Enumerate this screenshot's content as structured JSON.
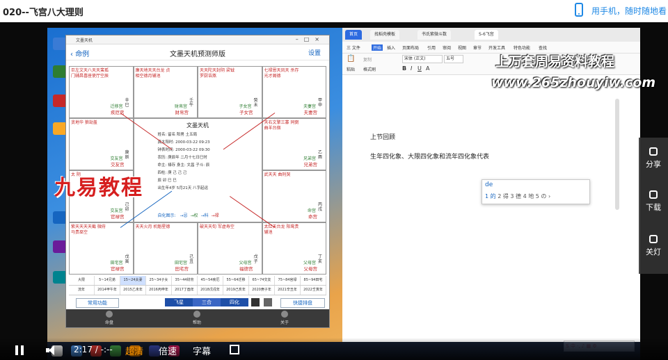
{
  "video": {
    "title": "020--飞宫八大理则",
    "mobile_link": "用手机，随时随地看"
  },
  "fushu": {
    "window_title": "文墨天机",
    "back_label": "命例",
    "app_title": "文墨天机预测师版",
    "settings_label": "设置",
    "palaces": [
      {
        "pos": "tl",
        "name": "疾厄宫",
        "gz": "辛巳",
        "stars": "巨左文天八天天蜚孤 门辅昌喜座使厅空辰",
        "main": "迁移宫"
      },
      {
        "pos": "t2",
        "name": "财帛宫",
        "gz": "壬午",
        "stars": "廉天地天天台龙 贞相空德月辅池",
        "main": "财帛宫"
      },
      {
        "pos": "t3",
        "name": "子女宫",
        "gz": "癸未",
        "stars": "天天陀天封阴 梁钺罗厨诰煞",
        "main": "子女宫"
      },
      {
        "pos": "tr",
        "name": "夫妻宫",
        "gz": "甲申",
        "stars": "七禄恩天凤天 杀存光才阁德",
        "main": "夫妻宫"
      },
      {
        "pos": "l2",
        "name": "交友宫",
        "gz": "庚辰",
        "stars": "贪地华 狼劫盖",
        "main": "交友宫"
      },
      {
        "pos": "r2",
        "name": "兄弟宫",
        "gz": "乙酉",
        "stars": "天右文擎三寡 同弼曲羊台宿",
        "main": "兄弟宫"
      },
      {
        "pos": "l3",
        "name": "官禄宫",
        "gz": "己卯",
        "stars": "太 阴",
        "main": "交友宫"
      },
      {
        "pos": "r3",
        "name": "命宫",
        "gz": "丙戌",
        "stars": "武天天 曲刑哭",
        "main": "命宫"
      },
      {
        "pos": "bl",
        "name": "官禄宫",
        "gz": "戊寅",
        "stars": "紫天天天天截 微府马贵巫空",
        "main": "田宅宫"
      },
      {
        "pos": "b2",
        "name": "田宅宫",
        "gz": "己丑",
        "stars": "天天火月 机魁星德",
        "main": "田宅宫"
      },
      {
        "pos": "b3",
        "name": "福德宫",
        "gz": "戊子",
        "stars": "破天天旬 军虚寿空",
        "main": "父母宫"
      },
      {
        "pos": "br",
        "name": "父母宫",
        "gz": "丁亥",
        "stars": "太红天台龙 阳鸾贵辅池",
        "main": "父母宫"
      }
    ],
    "center": {
      "title": "文墨天机",
      "lines": [
        "姓名: 留名    阳男  土五局",
        "真太阳时: 2000-03-22 09:23",
        "钟表时间: 2000-03-22 09:30",
        "农历: 庚辰年 二月十七日巳时",
        "命主: 禄存  身主: 文昌  子斗: 辰",
        "四柱: 庚  己  己  己",
        "      辰  卯  巳  巳",
        "出生年4岁  5月21天 八字起运"
      ],
      "sihua_label": "自化图示:",
      "sihua_items": [
        "→忌",
        "→权",
        "→科",
        "→禄"
      ]
    },
    "daxian_row": [
      "大限",
      "5~14兄弟",
      "15~24夫妻",
      "25~34子女",
      "35~44财帛",
      "45~54疾厄",
      "55~64迁移",
      "65~74交友",
      "75~84官禄",
      "85~94田宅"
    ],
    "liunian_row": [
      "流年",
      "2014甲午年",
      "2015乙未年",
      "2016丙申年",
      "2017丁酉年",
      "2018戊戌年",
      "2019己亥年",
      "2020庚子年",
      "2021辛丑年",
      "2022壬寅年"
    ],
    "buttons": {
      "common": "常用功能",
      "feixing": "飞星",
      "sanhe": "三合",
      "sihua": "四化",
      "kuaijie": "快捷排盘"
    },
    "bottom_nav": [
      "命盘",
      "帮助",
      "关于"
    ]
  },
  "wps": {
    "tabs": [
      "首页",
      "找稻壳模板",
      "书氏紫微斗数",
      "S-6飞宫"
    ],
    "menu": [
      "三 文件",
      "开始",
      "插入",
      "页面布局",
      "引用",
      "审阅",
      "视图",
      "章节",
      "开发工具",
      "特色功能",
      "查找"
    ],
    "font_name": "宋体 (正文)",
    "font_size": "五号",
    "paste_label": "粘贴",
    "copy_label": "复制",
    "format_label": "格式刷",
    "doc_heading": "上节回顾",
    "doc_line": "生年四化象、大限四化象和流年四化象代表",
    "ime_input": "de",
    "ime_candidates": [
      "1 的",
      "2 得",
      "3 德",
      "4 地",
      "5 の"
    ]
  },
  "watermarks": {
    "line1": "上万套周易资料教程",
    "line2": "www.265zhouyiw.com",
    "logo": "九易教程"
  },
  "sidepanel": [
    "分享",
    "下载",
    "关灯"
  ],
  "player": {
    "time": "2:17 / -:--",
    "quality": "超清",
    "speed": "倍速",
    "subtitle": "字幕"
  },
  "colors": {
    "accent": "#1e88e5",
    "quality": "#ff9800",
    "logo_red": "#d61f1f"
  }
}
